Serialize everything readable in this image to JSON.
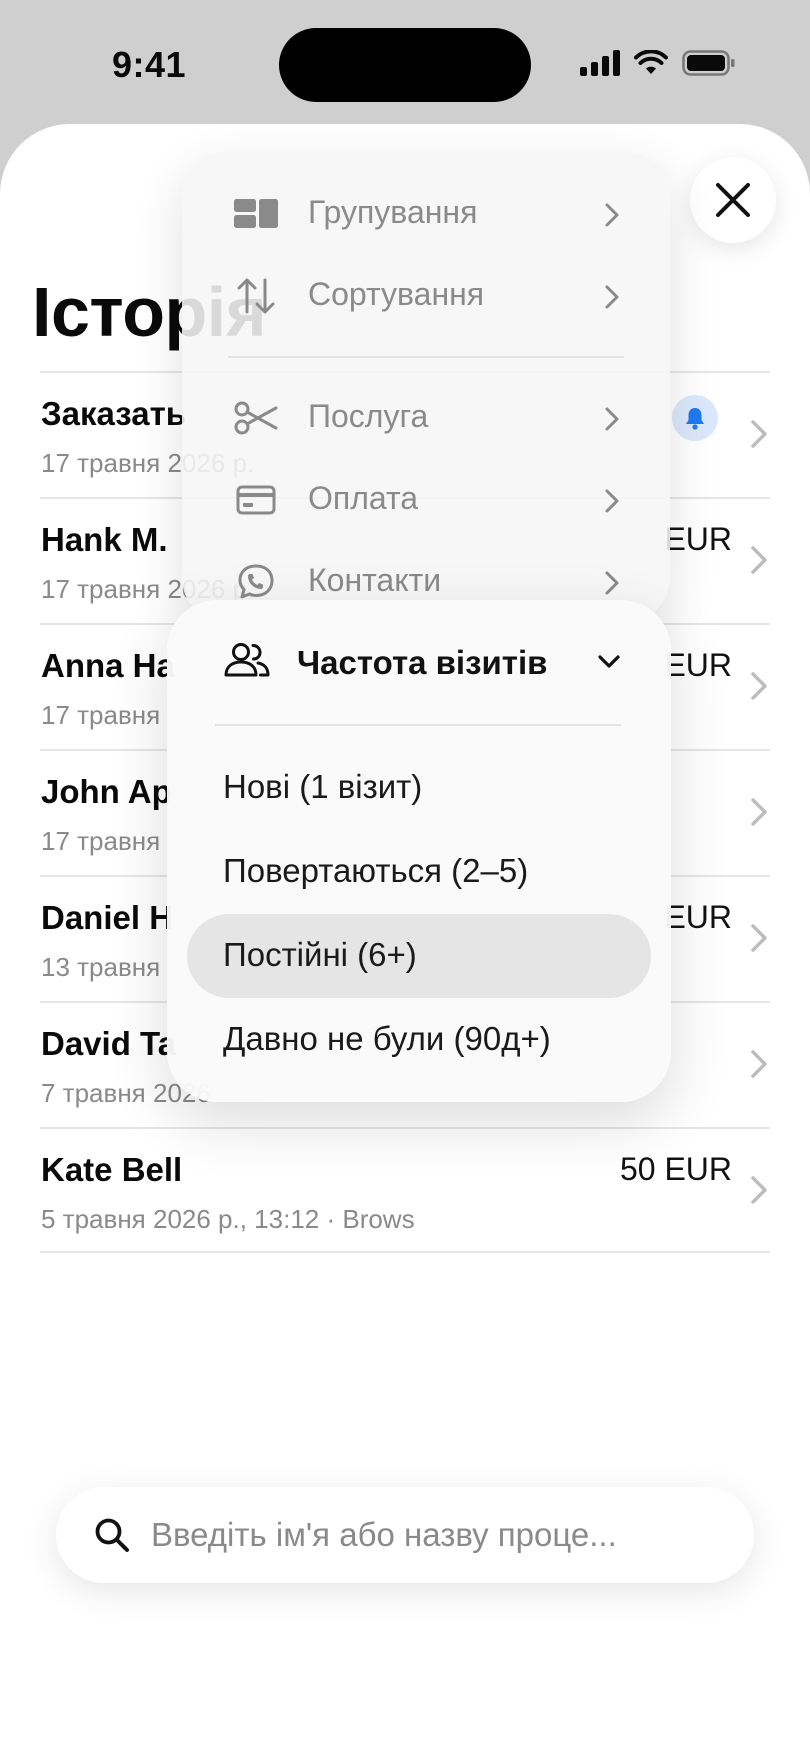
{
  "status": {
    "time": "9:41"
  },
  "page": {
    "title": "Історія"
  },
  "rows": [
    {
      "name": "Заказать",
      "sub": "17 травня 2026 р.",
      "price": "",
      "has_bell": true
    },
    {
      "name": "Hank M.",
      "sub": "17 травня 2026 р.",
      "price": "EUR"
    },
    {
      "name": "Anna Ha",
      "sub": "17 травня",
      "price": "EUR"
    },
    {
      "name": "John Ap",
      "sub": "17 травня",
      "price": ""
    },
    {
      "name": "Daniel H",
      "sub": "13 травня",
      "price": "EUR"
    },
    {
      "name": "David Ta",
      "sub": "7 травня 2026",
      "price": ""
    },
    {
      "name": "Kate Bell",
      "sub": "5 травня 2026 р., 13:12 · Brows",
      "price": "50 EUR"
    }
  ],
  "menu": {
    "items": [
      {
        "label": "Групування",
        "icon": "grid-icon"
      },
      {
        "label": "Сортування",
        "icon": "sort-arrows-icon"
      },
      {
        "label": "Послуга",
        "icon": "scissors-icon"
      },
      {
        "label": "Оплата",
        "icon": "credit-card-icon"
      },
      {
        "label": "Контакти",
        "icon": "phone-chat-icon"
      }
    ]
  },
  "submenu": {
    "title": "Частота візитів",
    "icon": "users-icon",
    "options": [
      {
        "label": "Нові (1 візит)",
        "selected": false
      },
      {
        "label": "Повертаються (2–5)",
        "selected": false
      },
      {
        "label": "Постійні (6+)",
        "selected": true
      },
      {
        "label": "Давно не були (90д+)",
        "selected": false
      }
    ]
  },
  "search": {
    "placeholder": "Введіть ім'я або назву проце..."
  },
  "colors": {
    "accent": "#1E7BF0",
    "bell_bg": "#DBE8FB",
    "muted": "#8A8A8A"
  }
}
